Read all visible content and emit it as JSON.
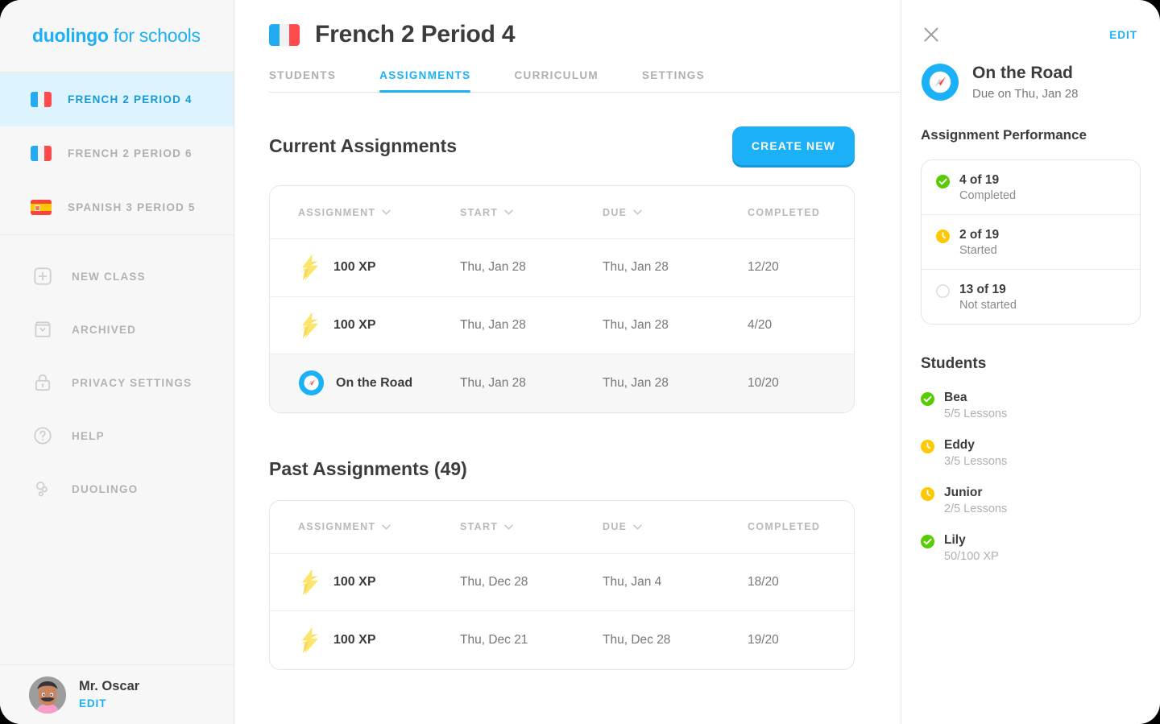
{
  "brand": {
    "bold": "duolingo",
    "rest": " for schools",
    "accent": "#1cb0f6"
  },
  "sidebar": {
    "classes": [
      {
        "label": "FRENCH 2 PERIOD 4",
        "flag": "flag-fr",
        "active": true
      },
      {
        "label": "FRENCH 2 PERIOD 6",
        "flag": "flag-fr",
        "active": false
      },
      {
        "label": "SPANISH 3 PERIOD 5",
        "flag": "flag-es",
        "active": false
      }
    ],
    "nav": [
      {
        "label": "NEW CLASS",
        "icon": "plus-square-icon"
      },
      {
        "label": "ARCHIVED",
        "icon": "archive-icon"
      },
      {
        "label": "PRIVACY SETTINGS",
        "icon": "lock-icon"
      },
      {
        "label": "HELP",
        "icon": "question-circle-icon"
      },
      {
        "label": "DUOLINGO",
        "icon": "duolingo-owl-icon"
      }
    ],
    "user": {
      "name": "Mr. Oscar",
      "edit_label": "EDIT"
    }
  },
  "header": {
    "title": "French 2 Period 4",
    "flag": "flag-fr",
    "tabs": [
      {
        "label": "STUDENTS",
        "active": false
      },
      {
        "label": "ASSIGNMENTS",
        "active": true
      },
      {
        "label": "CURRICULUM",
        "active": false
      },
      {
        "label": "SETTINGS",
        "active": false
      }
    ]
  },
  "current": {
    "title": "Current Assignments",
    "create_label": "CREATE NEW",
    "columns": [
      "ASSIGNMENT",
      "START",
      "DUE",
      "COMPLETED"
    ],
    "rows": [
      {
        "icon": "xp-bolt-icon",
        "name": "100 XP",
        "start": "Thu, Jan 28",
        "due": "Thu, Jan 28",
        "completed": "12/20",
        "selected": false
      },
      {
        "icon": "xp-bolt-icon",
        "name": "100 XP",
        "start": "Thu, Jan 28",
        "due": "Thu, Jan 28",
        "completed": "4/20",
        "selected": false
      },
      {
        "icon": "compass-icon",
        "name": "On the Road",
        "start": "Thu, Jan 28",
        "due": "Thu, Jan 28",
        "completed": "10/20",
        "selected": true
      }
    ]
  },
  "past": {
    "title": "Past Assignments (49)",
    "columns": [
      "ASSIGNMENT",
      "START",
      "DUE",
      "COMPLETED"
    ],
    "rows": [
      {
        "icon": "xp-bolt-icon",
        "name": "100 XP",
        "start": "Thu, Dec 28",
        "due": "Thu, Jan 4",
        "completed": "18/20"
      },
      {
        "icon": "xp-bolt-icon",
        "name": "100 XP",
        "start": "Thu, Dec 21",
        "due": "Thu, Dec 28",
        "completed": "19/20"
      }
    ]
  },
  "detail": {
    "edit_label": "EDIT",
    "assignment_name": "On the Road",
    "due_text": "Due on Thu, Jan 28",
    "performance_title": "Assignment Performance",
    "performance": [
      {
        "count": "4 of 19",
        "label": "Completed",
        "status": "completed",
        "color": "#58cc02"
      },
      {
        "count": "2 of 19",
        "label": "Started",
        "status": "started",
        "color": "#ffc800"
      },
      {
        "count": "13 of 19",
        "label": "Not started",
        "status": "not-started",
        "color": "#dcdcdc"
      }
    ],
    "students_title": "Students",
    "students": [
      {
        "name": "Bea",
        "progress": "5/5 Lessons",
        "status": "completed",
        "color": "#58cc02"
      },
      {
        "name": "Eddy",
        "progress": "3/5 Lessons",
        "status": "started",
        "color": "#ffc800"
      },
      {
        "name": "Junior",
        "progress": "2/5 Lessons",
        "status": "started",
        "color": "#ffc800"
      },
      {
        "name": "Lily",
        "progress": "50/100 XP",
        "status": "completed",
        "color": "#58cc02"
      }
    ]
  }
}
